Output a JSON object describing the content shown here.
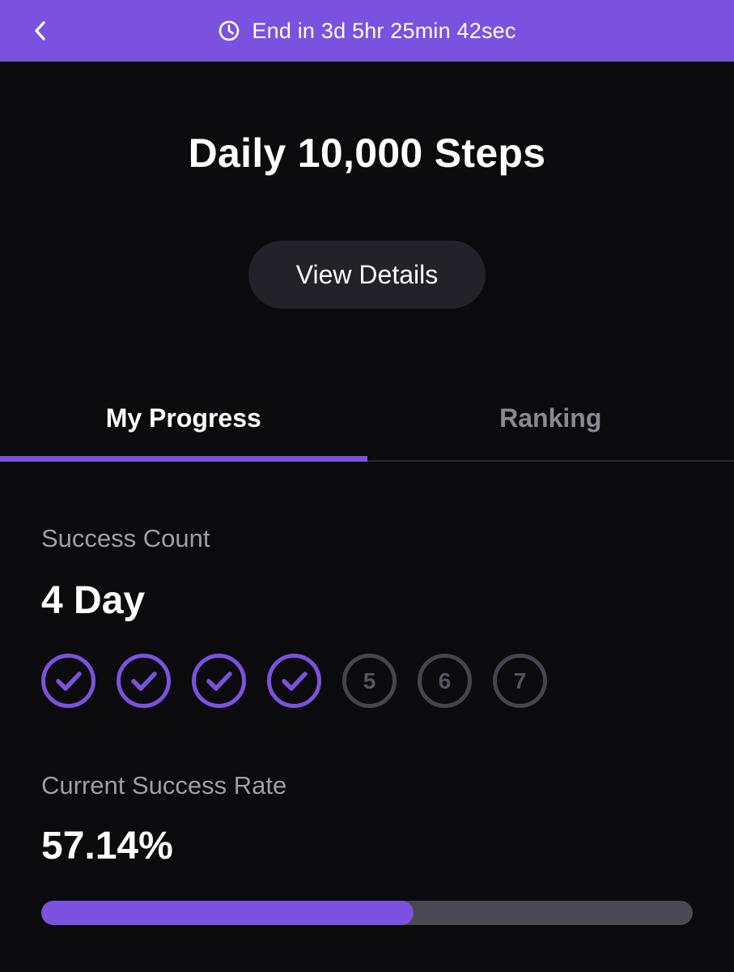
{
  "header": {
    "countdown_text": "End in 3d 5hr 25min 42sec",
    "back_icon": "chevron-left-icon",
    "clock_icon": "clock-icon",
    "background_color": "#7b52e0"
  },
  "challenge": {
    "title": "Daily 10,000 Steps",
    "details_button_label": "View Details"
  },
  "tabs": [
    {
      "label": "My Progress",
      "active": true
    },
    {
      "label": "Ranking",
      "active": false
    }
  ],
  "progress": {
    "success_count_label": "Success Count",
    "success_count_value": "4 Day",
    "days": [
      {
        "day": "1",
        "done": true
      },
      {
        "day": "2",
        "done": true
      },
      {
        "day": "3",
        "done": true
      },
      {
        "day": "4",
        "done": true
      },
      {
        "day": "5",
        "done": false
      },
      {
        "day": "6",
        "done": false
      },
      {
        "day": "7",
        "done": false
      }
    ],
    "success_rate_label": "Current Success Rate",
    "success_rate_value": "57.14%",
    "success_rate_fraction": 0.5714
  },
  "colors": {
    "accent": "#7b52e0",
    "background": "#0b0a0d",
    "button_bg": "#232228",
    "muted_text": "#9f9ea7",
    "pending_ring": "#46454d"
  }
}
